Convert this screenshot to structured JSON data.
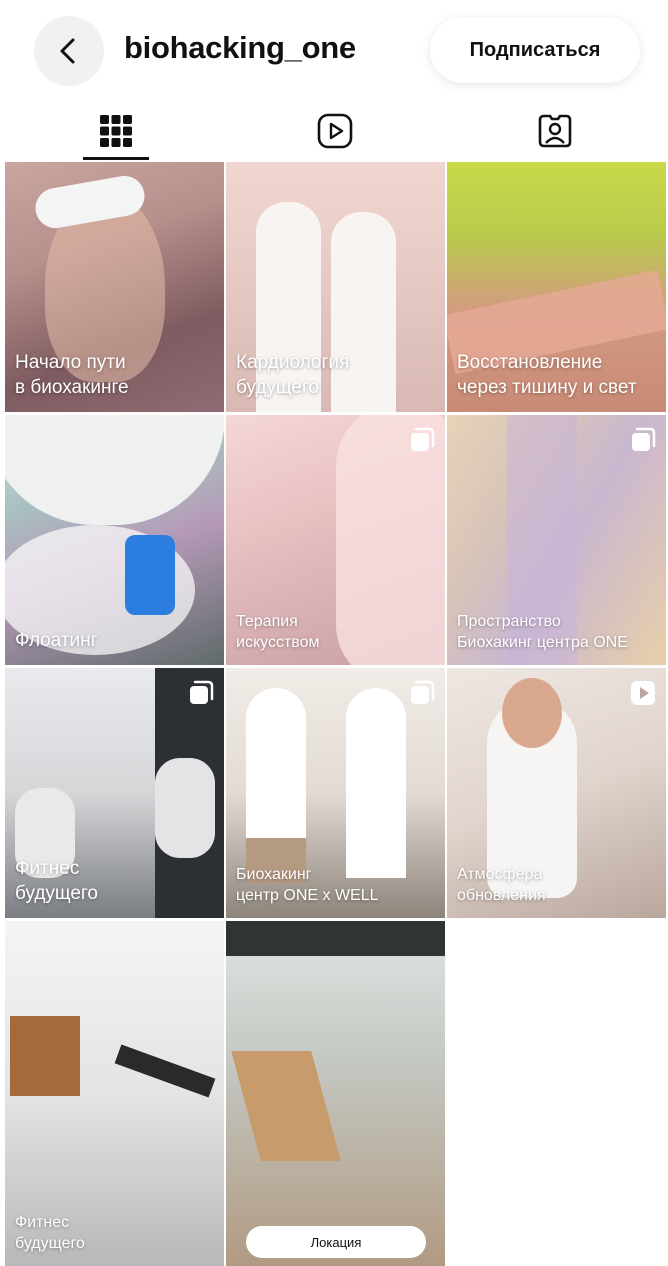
{
  "header": {
    "username": "biohacking_one",
    "follow_label": "Подписаться"
  },
  "tabs": [
    {
      "name": "grid",
      "icon": "grid-icon",
      "active": true
    },
    {
      "name": "reels",
      "icon": "reels-icon",
      "active": false
    },
    {
      "name": "tagged",
      "icon": "tagged-icon",
      "active": false
    }
  ],
  "posts": [
    {
      "caption": "Начало пути\nв биохакинге",
      "badge": null
    },
    {
      "caption": "Кардиология\nбудущего",
      "badge": null
    },
    {
      "caption": "Восстановление\nчерез тишину и свет",
      "badge": null
    },
    {
      "caption": "Флоатинг",
      "badge": null
    },
    {
      "caption": "Терапия\nискусством",
      "badge": "carousel-icon"
    },
    {
      "caption": "Пространство\nБиохакинг центра ONE",
      "badge": "carousel-icon"
    },
    {
      "caption": "Фитнес\nбудущего",
      "badge": "carousel-icon"
    },
    {
      "caption": "Биохакинг\nцентр ONE x WELL",
      "badge": "carousel-icon"
    },
    {
      "caption": "Атмосфера\nобновления",
      "badge": "reel-icon"
    },
    {
      "caption": "Фитнес\nбудущего",
      "badge": null
    },
    {
      "caption": "",
      "badge": null,
      "pill": "Локация"
    }
  ],
  "colors": {
    "text": "#111111",
    "button_bg": "#f1f1f1",
    "background": "#ffffff"
  }
}
